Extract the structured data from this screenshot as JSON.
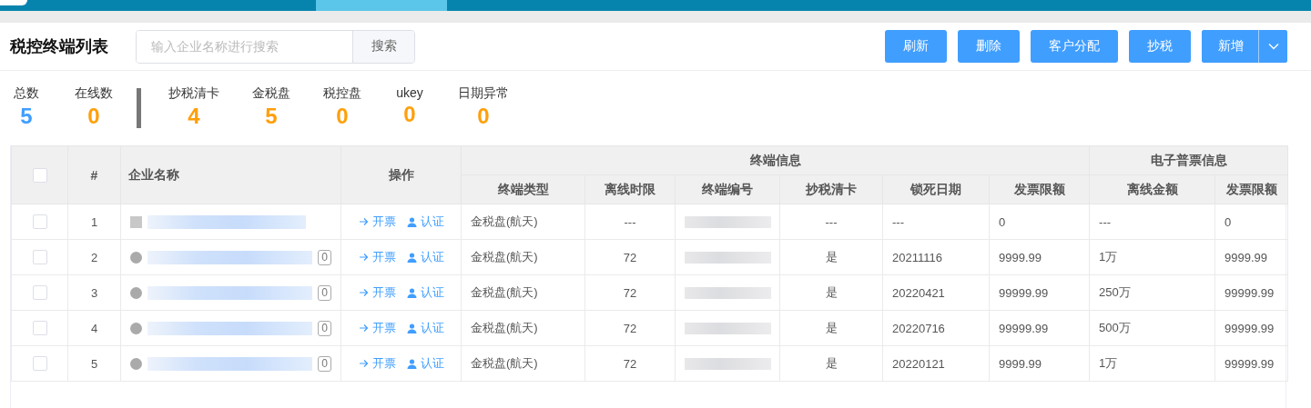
{
  "nav_tabs": [
    {
      "selected": false
    },
    {
      "selected": true
    },
    {
      "selected": false
    }
  ],
  "title": "税控终端列表",
  "search": {
    "placeholder": "输入企业名称进行搜索",
    "button": "搜索"
  },
  "actions": [
    {
      "label": "刷新",
      "kind": "plain"
    },
    {
      "label": "删除",
      "kind": "plain"
    },
    {
      "label": "客户分配",
      "kind": "plain"
    },
    {
      "label": "抄税",
      "kind": "plain"
    },
    {
      "label": "新增",
      "kind": "split"
    }
  ],
  "stats": [
    {
      "label": "总数",
      "value": "5",
      "color": "#409eff"
    },
    {
      "label": "在线数",
      "value": "0",
      "color": "#ff9f0a"
    },
    {
      "kind": "divider"
    },
    {
      "label": "抄税清卡",
      "value": "4",
      "color": "#ff9f0a"
    },
    {
      "label": "金税盘",
      "value": "5",
      "color": "#ff9f0a"
    },
    {
      "label": "税控盘",
      "value": "0",
      "color": "#ff9f0a"
    },
    {
      "label": "ukey",
      "value": "0",
      "color": "#ff9f0a"
    },
    {
      "label": "日期异常",
      "value": "0",
      "color": "#ff9f0a"
    }
  ],
  "table": {
    "select_all_checked": false,
    "groups": [
      {
        "label": "终端信息"
      },
      {
        "label": "电子普票信息"
      }
    ],
    "columns": [
      "#",
      "企业名称",
      "操作",
      "终端类型",
      "离线时限",
      "终端编号",
      "抄税清卡",
      "锁死日期",
      "发票限额",
      "离线金额",
      "发票限额"
    ],
    "rows": [
      {
        "checked": false,
        "index": "1",
        "kind": "square",
        "actions": [
          {
            "kind": "invoice",
            "label": "开票"
          },
          {
            "kind": "certify",
            "label": "认证"
          }
        ],
        "terminal_type": "金税盘(航天)",
        "offline_limit": "---",
        "copy_clear": "---",
        "lock_date": "---",
        "invoice_limit": "0",
        "offline_amount": "---",
        "invoice_limit_2": "0"
      },
      {
        "checked": false,
        "index": "2",
        "kind": "dot",
        "badge": "0",
        "actions": [
          {
            "kind": "invoice",
            "label": "开票"
          },
          {
            "kind": "certify",
            "label": "认证"
          }
        ],
        "terminal_type": "金税盘(航天)",
        "offline_limit": "72",
        "copy_clear": "是",
        "lock_date": "20211116",
        "invoice_limit": "9999.99",
        "offline_amount": "1万",
        "invoice_limit_2": "9999.99"
      },
      {
        "checked": false,
        "index": "3",
        "kind": "dot",
        "badge": "0",
        "actions": [
          {
            "kind": "invoice",
            "label": "开票"
          },
          {
            "kind": "certify",
            "label": "认证"
          }
        ],
        "terminal_type": "金税盘(航天)",
        "offline_limit": "72",
        "copy_clear": "是",
        "lock_date": "20220421",
        "invoice_limit": "99999.99",
        "offline_amount": "250万",
        "invoice_limit_2": "99999.99"
      },
      {
        "checked": false,
        "index": "4",
        "kind": "dot",
        "badge": "0",
        "actions": [
          {
            "kind": "invoice",
            "label": "开票"
          },
          {
            "kind": "certify",
            "label": "认证"
          }
        ],
        "terminal_type": "金税盘(航天)",
        "offline_limit": "72",
        "copy_clear": "是",
        "lock_date": "20220716",
        "invoice_limit": "99999.99",
        "offline_amount": "500万",
        "invoice_limit_2": "99999.99"
      },
      {
        "checked": false,
        "index": "5",
        "kind": "dot",
        "badge": "0",
        "actions": [
          {
            "kind": "invoice",
            "label": "开票"
          },
          {
            "kind": "certify",
            "label": "认证"
          }
        ],
        "terminal_type": "金税盘(航天)",
        "offline_limit": "72",
        "copy_clear": "是",
        "lock_date": "20220121",
        "invoice_limit": "9999.99",
        "offline_amount": "1万",
        "invoice_limit_2": "99999.99"
      }
    ]
  }
}
